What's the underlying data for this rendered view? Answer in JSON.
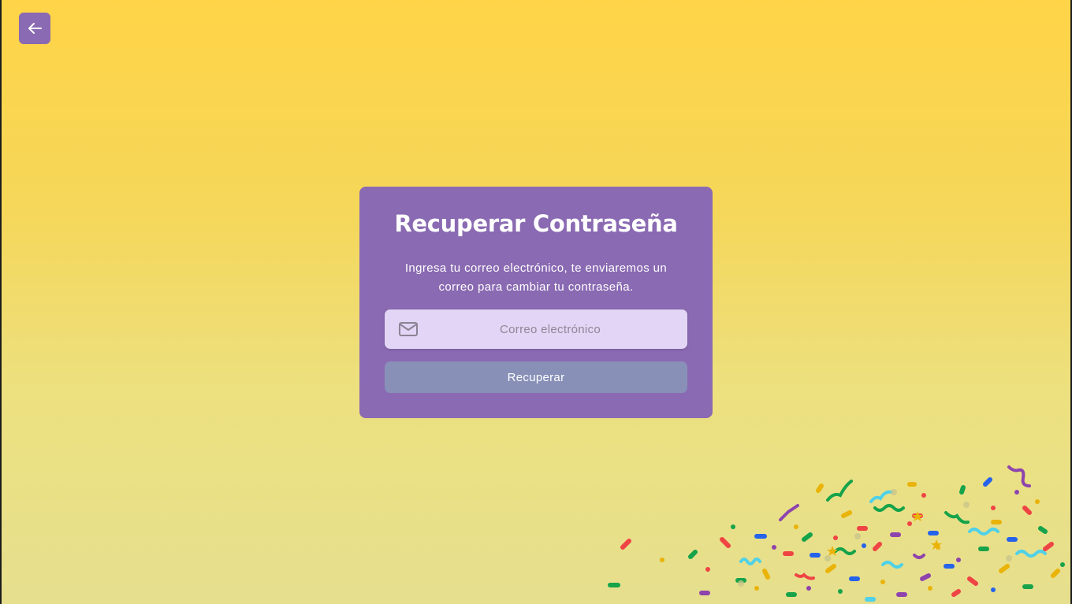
{
  "back_button": {
    "icon": "arrow-left-icon",
    "label": ""
  },
  "card": {
    "title": "Recuperar Contraseña",
    "description": "Ingresa tu correo electrónico, te enviaremos un correo para cambiar tu contraseña.",
    "email_field": {
      "icon": "mail-icon",
      "placeholder": "Correo electrónico",
      "value": ""
    },
    "submit_label": "Recuperar"
  },
  "colors": {
    "background_top": "#ffd447",
    "background_bottom": "#e6df8e",
    "card": "#8a6ab2",
    "input": "#e2d5f5",
    "button": "#8890b8"
  },
  "decoration": {
    "confetti": "confetti-graphic"
  }
}
